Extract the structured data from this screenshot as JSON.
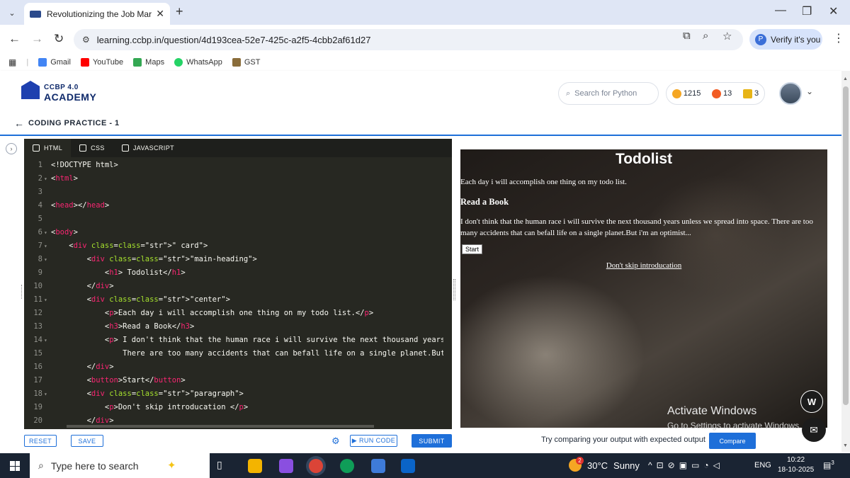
{
  "browser": {
    "tab_title": "Revolutionizing the Job Market",
    "tab_close": "✕",
    "new_tab": "+",
    "url": "learning.ccbp.in/question/4d193cea-52e7-425c-a2f5-4cbb2af61d27",
    "verify_label": "Verify it's you",
    "verify_badge": "P",
    "bookmarks": [
      {
        "label": "Gmail",
        "color": "#ea4335"
      },
      {
        "label": "YouTube",
        "color": "#ff0000"
      },
      {
        "label": "Maps",
        "color": "#34a853"
      },
      {
        "label": "WhatsApp",
        "color": "#25d366"
      },
      {
        "label": "GST",
        "color": "#8a6d3b"
      }
    ]
  },
  "app": {
    "logo_top": "CCBP 4.0",
    "logo_bottom": "ACADEMY",
    "search_placeholder": "Search for Python",
    "stats": {
      "coins": "1215",
      "streak": "13",
      "trophies": "3"
    },
    "coding_title": "CODING PRACTICE - 1"
  },
  "editor": {
    "tabs": [
      "HTML",
      "CSS",
      "JAVASCRIPT"
    ],
    "active_tab": "HTML",
    "lines": [
      {
        "n": "1",
        "fold": "",
        "code": "<!DOCTYPE html>"
      },
      {
        "n": "2",
        "fold": "▾",
        "code": "<html>"
      },
      {
        "n": "3",
        "fold": "",
        "code": ""
      },
      {
        "n": "4",
        "fold": "",
        "code": "<head></head>"
      },
      {
        "n": "5",
        "fold": "",
        "code": ""
      },
      {
        "n": "6",
        "fold": "▾",
        "code": "<body>"
      },
      {
        "n": "7",
        "fold": "▾",
        "code": "    <div class=\" card\">"
      },
      {
        "n": "8",
        "fold": "▾",
        "code": "        <div class=\"main-heading\">"
      },
      {
        "n": "9",
        "fold": "",
        "code": "            <h1> Todolist</h1>"
      },
      {
        "n": "10",
        "fold": "",
        "code": "        </div>"
      },
      {
        "n": "11",
        "fold": "▾",
        "code": "        <div class=\"center\">"
      },
      {
        "n": "12",
        "fold": "",
        "code": "            <p>Each day i will accomplish one thing on my todo list.</p>"
      },
      {
        "n": "13",
        "fold": "",
        "code": "            <h3>Read a Book</h3>"
      },
      {
        "n": "14",
        "fold": "▾",
        "code": "            <p> I don't think that the human race i will survive the next thousand years u"
      },
      {
        "n": "15",
        "fold": "",
        "code": "                There are too many accidents that can befall life on a single planet.But i"
      },
      {
        "n": "16",
        "fold": "",
        "code": "        </div>"
      },
      {
        "n": "17",
        "fold": "",
        "code": "        <button>Start</button>"
      },
      {
        "n": "18",
        "fold": "▾",
        "code": "        <div class=\"paragraph\">"
      },
      {
        "n": "19",
        "fold": "",
        "code": "            <p>Don't skip introducation </p>"
      },
      {
        "n": "20",
        "fold": "",
        "code": "        </div>"
      }
    ],
    "buttons": {
      "reset": "RESET",
      "save": "SAVE",
      "run": "▶ RUN CODE",
      "submit": "SUBMIT"
    }
  },
  "preview": {
    "h1": "Todolist",
    "p1": "Each day i will accomplish one thing on my todo list.",
    "h3": "Read a Book",
    "p2": "I don't think that the human race i will survive the next thousand years unless we spread into space. There are too many accidents that can befall life on a single planet.But i'm an optimist...",
    "button": "Start",
    "p3": "Don't skip introducation"
  },
  "compare": {
    "text": "Try comparing your output with expected output",
    "button": "Compare"
  },
  "watermark": {
    "title": "Activate Windows",
    "subtitle": "Go to Settings to activate Windows."
  },
  "taskbar": {
    "search_placeholder": "Type here to search",
    "weather_temp": "30°C",
    "weather_desc": "Sunny",
    "weather_badge": "2",
    "language": "ENG",
    "time": "10:22",
    "date": "18-10-2025",
    "notif_count": "3"
  }
}
